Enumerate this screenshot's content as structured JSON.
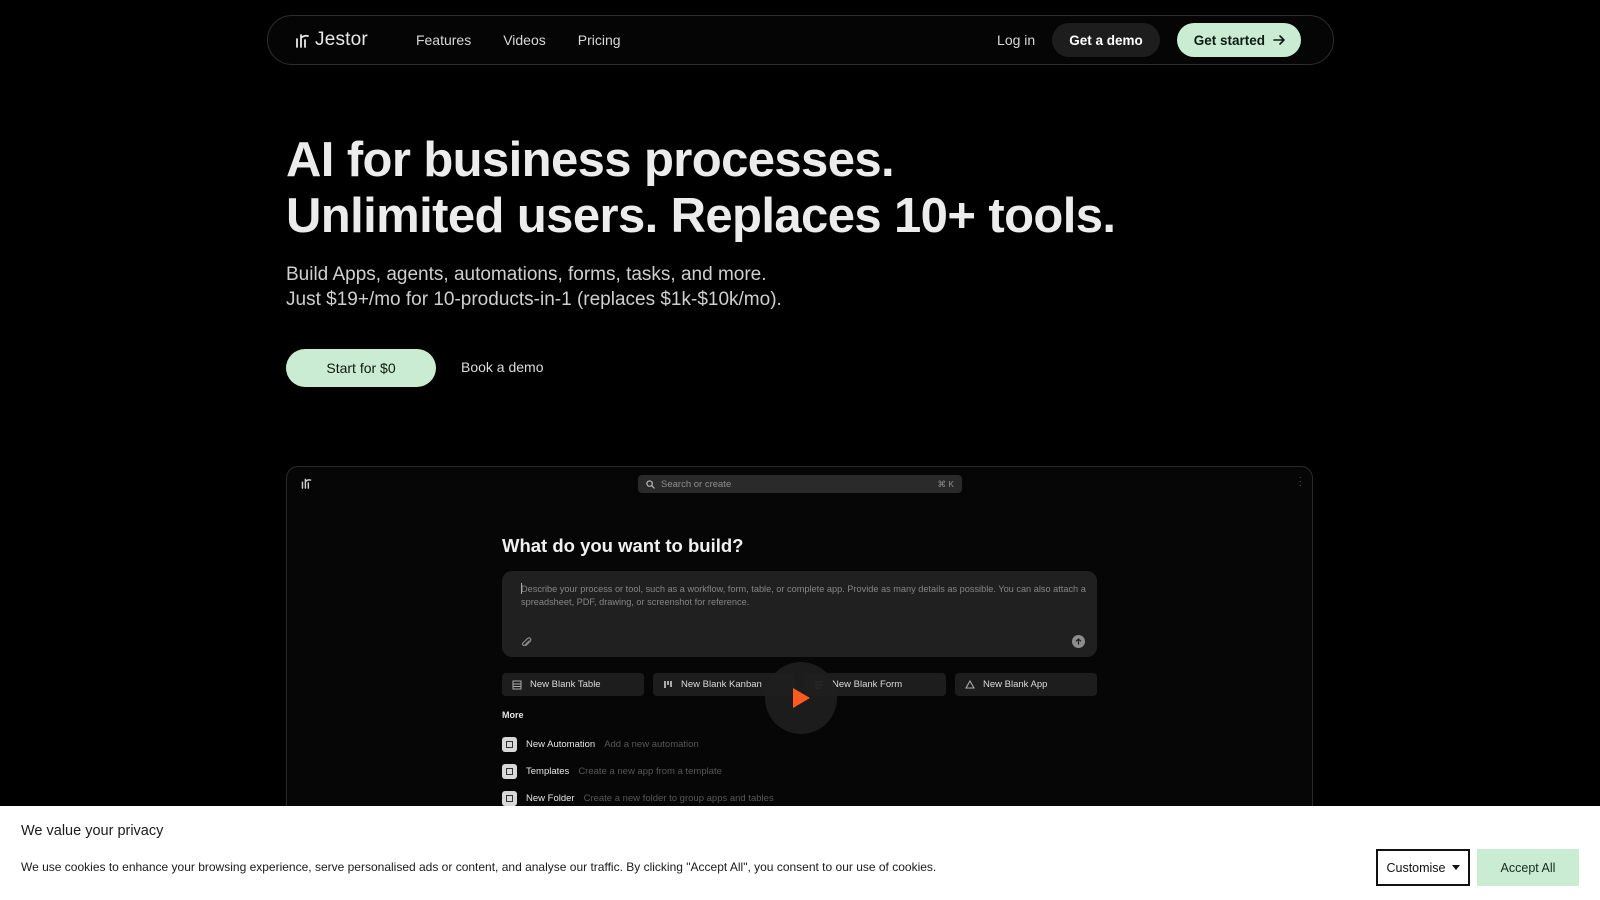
{
  "nav": {
    "logo_text": "Jestor",
    "links": [
      "Features",
      "Videos",
      "Pricing"
    ],
    "login": "Log in",
    "get_demo": "Get a demo",
    "get_started": "Get started"
  },
  "hero": {
    "title_line1": "AI for business processes.",
    "title_line2": "Unlimited users. Replaces 10+ tools.",
    "sub_line1": "Build Apps, agents, automations, forms, tasks, and more.",
    "sub_line2": "Just $19+/mo for 10-products-in-1 (replaces $1k-$10k/mo).",
    "cta_primary": "Start for $0",
    "cta_secondary": "Book a demo"
  },
  "preview": {
    "search_placeholder": "Search or create",
    "search_shortcut": "⌘ K",
    "heading": "What do you want to build?",
    "prompt_placeholder": "Describe your process or tool, such as a workflow, form, table, or complete app. Provide as many details as possible. You can also attach a spreadsheet, PDF, drawing, or screenshot for reference.",
    "chips": [
      "New Blank Table",
      "New Blank Kanban",
      "New Blank Form",
      "New Blank App"
    ],
    "more_label": "More",
    "more_items": [
      {
        "name": "New Automation",
        "desc": "Add a new automation"
      },
      {
        "name": "Templates",
        "desc": "Create a new app from a template"
      },
      {
        "name": "New Folder",
        "desc": "Create a new folder to group apps and tables"
      }
    ]
  },
  "cookie": {
    "title": "We value your privacy",
    "text": "We use cookies to enhance your browsing experience, serve personalised ads or content, and analyse our traffic. By clicking \"Accept All\", you consent to our use of cookies.",
    "customise": "Customise",
    "accept": "Accept All"
  },
  "colors": {
    "background": "#000000",
    "accent": "#c9ecd2",
    "play": "#ff5a1f"
  }
}
